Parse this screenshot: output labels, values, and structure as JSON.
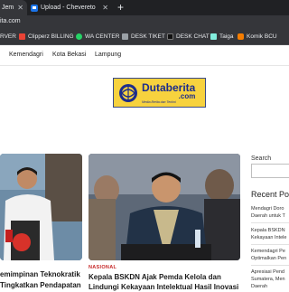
{
  "browser": {
    "tabs": [
      {
        "title": "Jem"
      },
      {
        "title": "Upload - Chevereto"
      }
    ],
    "address": "ita.com"
  },
  "bookmarks": [
    {
      "label": "RVER",
      "icon": "bookmark-icon",
      "color": "#9aa0a6"
    },
    {
      "label": "Clipperz BILLING",
      "icon": "clipperz-icon",
      "color": "#ea4335"
    },
    {
      "label": "WA CENTER",
      "icon": "whatsapp-icon",
      "color": "#25d366"
    },
    {
      "label": "DESK TIKET",
      "icon": "desk-icon",
      "color": "#9aa0a6"
    },
    {
      "label": "DESK CHAT",
      "icon": "desk-icon",
      "color": "#202124"
    },
    {
      "label": "Taiga",
      "icon": "taiga-icon",
      "color": "#83eede"
    },
    {
      "label": "Komik BCU",
      "icon": "blogger-icon",
      "color": "#f57d00"
    }
  ],
  "nav": {
    "items": [
      "Kemendagri",
      "Kota Bekasi",
      "Lampung"
    ]
  },
  "logo": {
    "main": "Dutaberita",
    "domain": ".com",
    "tagline": "Media Berita dan Terkini"
  },
  "articles": [
    {
      "category": "",
      "line1": "emimpinan Teknokratik",
      "line2": "Tingkatkan Pendapatan"
    },
    {
      "category": "NASIONAL",
      "line1": "Kepala BSKDN Ajak Pemda Kelola dan",
      "line2": "Lindungi Kekayaan Intelektual Hasil Inovasi"
    }
  ],
  "sidebar": {
    "search_label": "Search",
    "recent_title": "Recent Po",
    "recent_posts": [
      {
        "line1": "Mendagri Doro",
        "line2": "Daerah untuk T"
      },
      {
        "line1": "Kepala BSKDN",
        "line2": "Kekayaan Intele"
      },
      {
        "line1": "Kemendagri Pe",
        "line2": "Optimalkan Pen"
      },
      {
        "line1": "Apresiasi Pend",
        "line2": "Sumatera, Men",
        "line3": "Daerah"
      }
    ]
  },
  "colors": {
    "browser_dark": "#202124",
    "browser_toolbar": "#35363a",
    "category_red": "#c62828",
    "logo_yellow": "#f7d23e",
    "logo_blue": "#1c2c8c"
  }
}
